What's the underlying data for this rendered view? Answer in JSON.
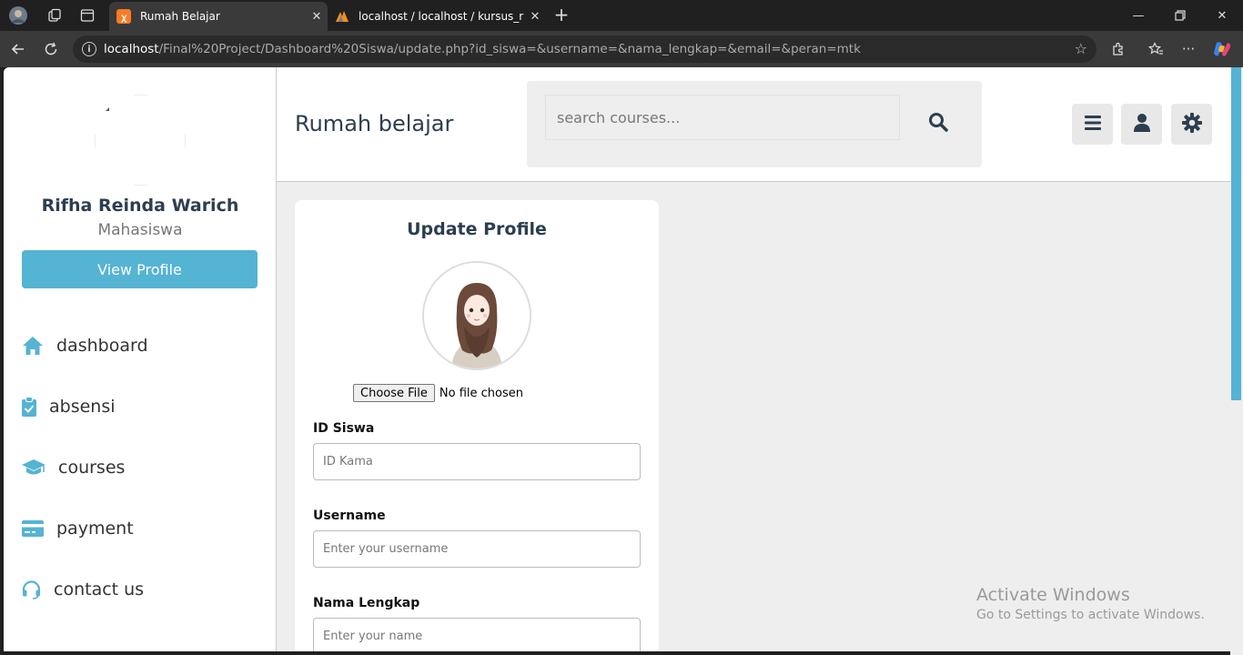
{
  "browser": {
    "tabs": [
      {
        "title": "Rumah Belajar",
        "active": true
      },
      {
        "title": "localhost / localhost / kursus_rum",
        "active": false
      }
    ],
    "url": {
      "host": "localhost",
      "path": "/Final%20Project/Dashboard%20Siswa/update.php?id_siswa=&username=&nama_lengkap=&email=&peran=mtk"
    }
  },
  "sidebar": {
    "student_name": "Rifha Reinda Warich",
    "student_role": "Mahasiswa",
    "view_profile_label": "View Profile",
    "menu": [
      {
        "label": "dashboard",
        "icon": "home-icon"
      },
      {
        "label": "absensi",
        "icon": "clipboard-check-icon"
      },
      {
        "label": "courses",
        "icon": "graduation-cap-icon"
      },
      {
        "label": "payment",
        "icon": "credit-card-icon"
      },
      {
        "label": "contact us",
        "icon": "headset-icon"
      }
    ]
  },
  "header": {
    "logo": "Rumah belajar",
    "search_placeholder": "search courses..."
  },
  "form": {
    "title": "Update Profile",
    "file_button": "Choose File",
    "file_status": "No file chosen",
    "fields": [
      {
        "label": "ID Siswa",
        "placeholder": "ID Kama"
      },
      {
        "label": "Username",
        "placeholder": "Enter your username"
      },
      {
        "label": "Nama Lengkap",
        "placeholder": "Enter your name"
      }
    ]
  },
  "watermark": {
    "line1": "Activate Windows",
    "line2": "Go to Settings to activate Windows."
  },
  "colors": {
    "accent": "#55b3d3",
    "text_dark": "#2c3e50",
    "page_bg": "#eeeeee"
  }
}
